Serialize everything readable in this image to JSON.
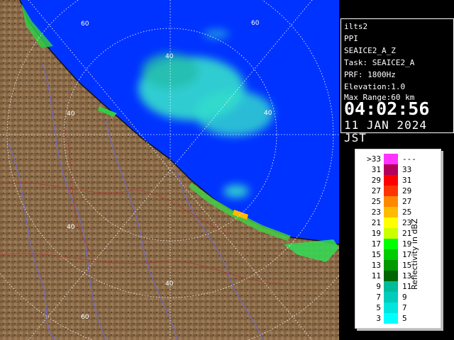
{
  "info": {
    "site": "ilts2",
    "mode": "PPI",
    "product": "SEAICE2_A_Z",
    "task": "Task: SEAICE2_A",
    "prf": "PRF: 1800Hz",
    "elevation": "Elevation:1.0",
    "max_range": "Max Range:60 km",
    "time": "04:02:56",
    "date": "11 JAN 2024 JST"
  },
  "range_labels": [
    "60",
    "60",
    "40",
    "40",
    "40",
    "40",
    "40",
    "60"
  ],
  "legend": {
    "unit": "Reflectivity in dBZ",
    "rows": [
      {
        "left": ">33",
        "right": "---",
        "color": "#ff33ff"
      },
      {
        "left": "31",
        "right": "33",
        "color": "#b4005a"
      },
      {
        "left": "29",
        "right": "31",
        "color": "#ff0000"
      },
      {
        "left": "27",
        "right": "29",
        "color": "#ff3300"
      },
      {
        "left": "25",
        "right": "27",
        "color": "#ff8800"
      },
      {
        "left": "23",
        "right": "25",
        "color": "#ffbb00"
      },
      {
        "left": "21",
        "right": "23",
        "color": "#ffff00"
      },
      {
        "left": "19",
        "right": "21",
        "color": "#ccff00"
      },
      {
        "left": "17",
        "right": "19",
        "color": "#00ff00"
      },
      {
        "left": "15",
        "right": "17",
        "color": "#00cc00"
      },
      {
        "left": "13",
        "right": "15",
        "color": "#009900"
      },
      {
        "left": "11",
        "right": "13",
        "color": "#006600"
      },
      {
        "left": "9",
        "right": "11",
        "color": "#00bb99"
      },
      {
        "left": "7",
        "right": "9",
        "color": "#00ccbb"
      },
      {
        "left": "5",
        "right": "7",
        "color": "#00e5dd"
      },
      {
        "left": "3",
        "right": "5",
        "color": "#00ffff"
      }
    ]
  },
  "colors": {
    "sea": "#0033ff",
    "land": "#8b6b48",
    "echo_weak": "#33ddcc",
    "ring": "#ffffff"
  }
}
